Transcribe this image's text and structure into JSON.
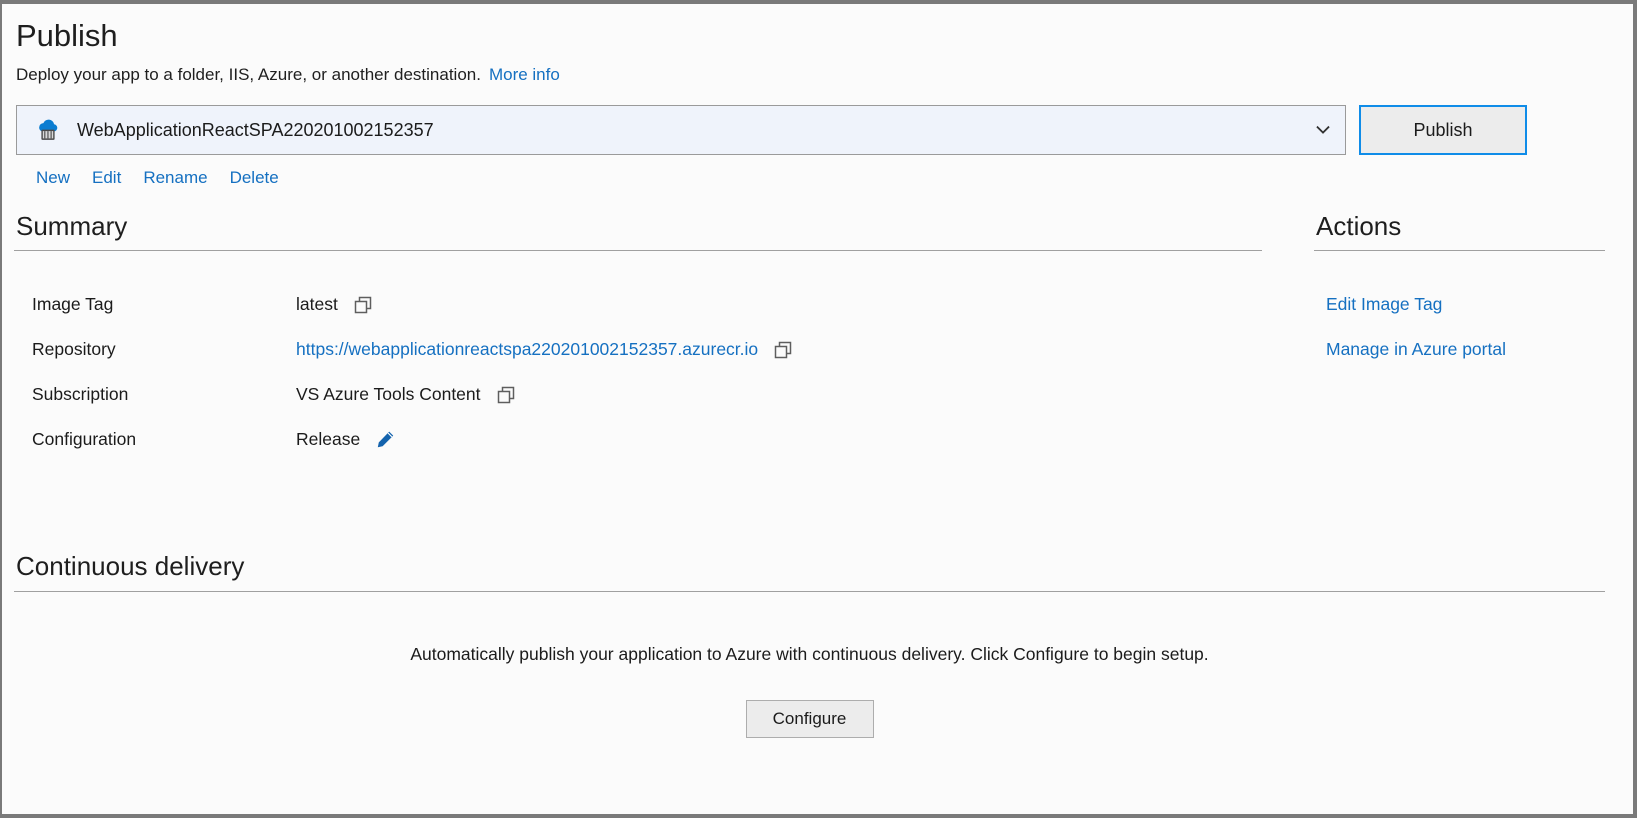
{
  "window": {
    "title": "Publish",
    "subtitle": "Deploy your app to a folder, IIS, Azure, or another destination.",
    "more_info_label": "More info"
  },
  "profile": {
    "name": "WebApplicationReactSPA220201002152357",
    "icon": "azure-container-registry-icon",
    "dropdown_icon": "chevron-down-icon",
    "publish_button": "Publish",
    "links": [
      {
        "label": "New",
        "name": "new-profile-link"
      },
      {
        "label": "Edit",
        "name": "edit-profile-link"
      },
      {
        "label": "Rename",
        "name": "rename-profile-link"
      },
      {
        "label": "Delete",
        "name": "delete-profile-link"
      }
    ]
  },
  "summary": {
    "heading": "Summary",
    "rows": [
      {
        "label": "Image Tag",
        "value": "latest",
        "is_link": false,
        "icon": "copy-icon"
      },
      {
        "label": "Repository",
        "value": "https://webapplicationreactspa220201002152357.azurecr.io",
        "is_link": true,
        "icon": "copy-icon"
      },
      {
        "label": "Subscription",
        "value": "VS Azure Tools Content",
        "is_link": false,
        "icon": "copy-icon"
      },
      {
        "label": "Configuration",
        "value": "Release",
        "is_link": false,
        "icon": "pencil-icon"
      }
    ]
  },
  "actions": {
    "heading": "Actions",
    "items": [
      {
        "label": "Edit Image Tag",
        "name": "edit-image-tag-link"
      },
      {
        "label": "Manage in Azure portal",
        "name": "manage-in-azure-portal-link"
      }
    ]
  },
  "continuous_delivery": {
    "heading": "Continuous delivery",
    "description": "Automatically publish your application to Azure with continuous delivery. Click Configure to begin setup.",
    "configure_button": "Configure"
  },
  "colors": {
    "link": "#1570c1",
    "accent_focus": "#0f8ce8",
    "text": "#1b1b1b",
    "rule": "#a0a0a0",
    "select_bg": "#eff3fb",
    "button_bg": "#ececec",
    "window_border": "#7a7a7a",
    "acr_cloud": "#0078d4",
    "acr_body": "#5d5d5d"
  }
}
